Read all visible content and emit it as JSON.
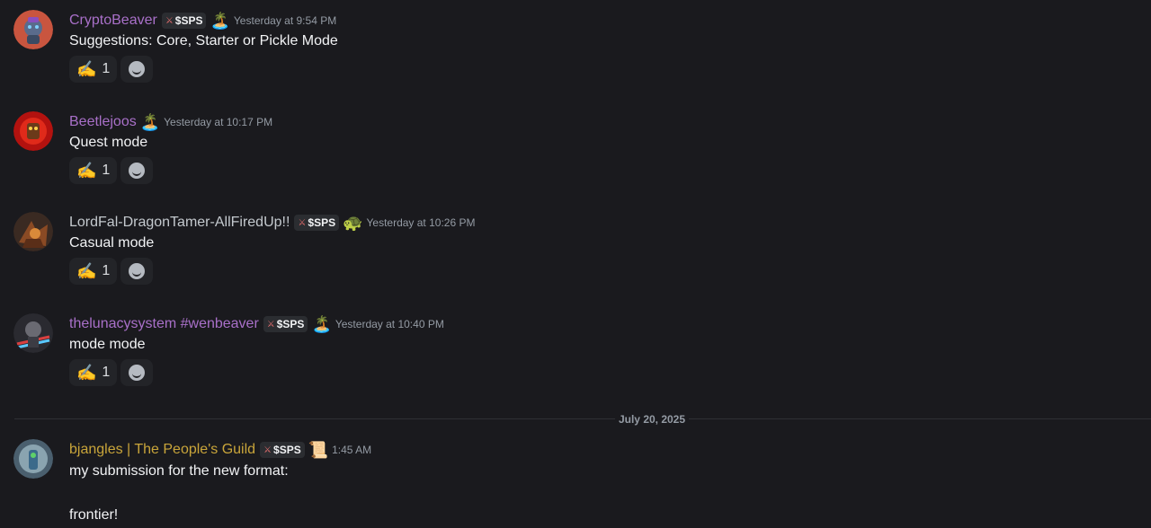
{
  "messages": [
    {
      "username": "CryptoBeaver",
      "username_color": "#a970c9",
      "tag": "$SPS",
      "badge": "🏝️",
      "timestamp": "Yesterday at 9:54 PM",
      "content": "Suggestions: Core, Starter or Pickle Mode",
      "reaction": {
        "emoji": "✍️",
        "count": "1"
      }
    },
    {
      "username": "Beetlejoos",
      "username_color": "#a970c9",
      "badge": "🏝️",
      "timestamp": "Yesterday at 10:17 PM",
      "content": "Quest mode",
      "reaction": {
        "emoji": "✍️",
        "count": "1"
      }
    },
    {
      "username": "LordFal-DragonTamer-AllFiredUp!!",
      "username_color": "#c4c9ce",
      "tag": "$SPS",
      "badge": "🐢",
      "timestamp": "Yesterday at 10:26 PM",
      "content": "Casual mode",
      "reaction": {
        "emoji": "✍️",
        "count": "1"
      }
    },
    {
      "username": "thelunacysystem #wenbeaver",
      "username_color": "#a970c9",
      "tag": "$SPS",
      "badge": "🏝️",
      "timestamp": "Yesterday at 10:40 PM",
      "content": "mode mode",
      "reaction": {
        "emoji": "✍️",
        "count": "1"
      }
    },
    {
      "username": "bjangles | The People's Guild",
      "username_color": "#c9a53a",
      "tag": "$SPS",
      "badge": "📜",
      "timestamp": "1:45 AM",
      "content": "my submission for the new format:\n\nfrontier!"
    }
  ],
  "date_divider": "July 20, 2025"
}
